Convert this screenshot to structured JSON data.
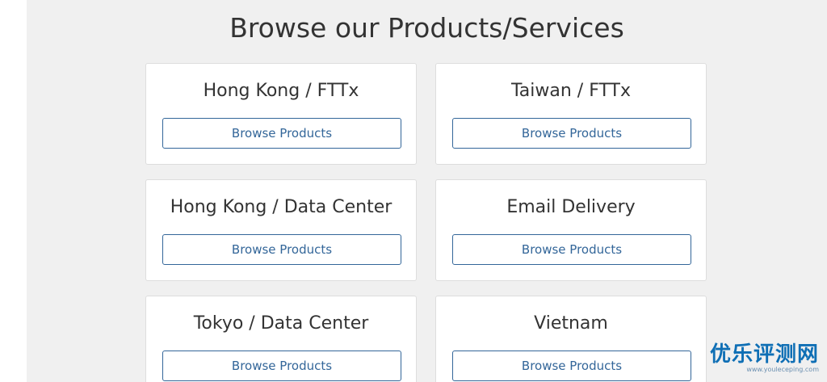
{
  "heading": "Browse our Products/Services",
  "categories": [
    {
      "title": "Hong Kong / FTTx",
      "button": "Browse Products"
    },
    {
      "title": "Taiwan / FTTx",
      "button": "Browse Products"
    },
    {
      "title": "Hong Kong / Data Center",
      "button": "Browse Products"
    },
    {
      "title": "Email Delivery",
      "button": "Browse Products"
    },
    {
      "title": "Tokyo / Data Center",
      "button": "Browse Products"
    },
    {
      "title": "Vietnam",
      "button": "Browse Products"
    }
  ],
  "watermark": {
    "main": "优乐评测网",
    "sub": "www.youleceping.com"
  },
  "colors": {
    "accent": "#336699",
    "background": "#f0f0f0"
  }
}
